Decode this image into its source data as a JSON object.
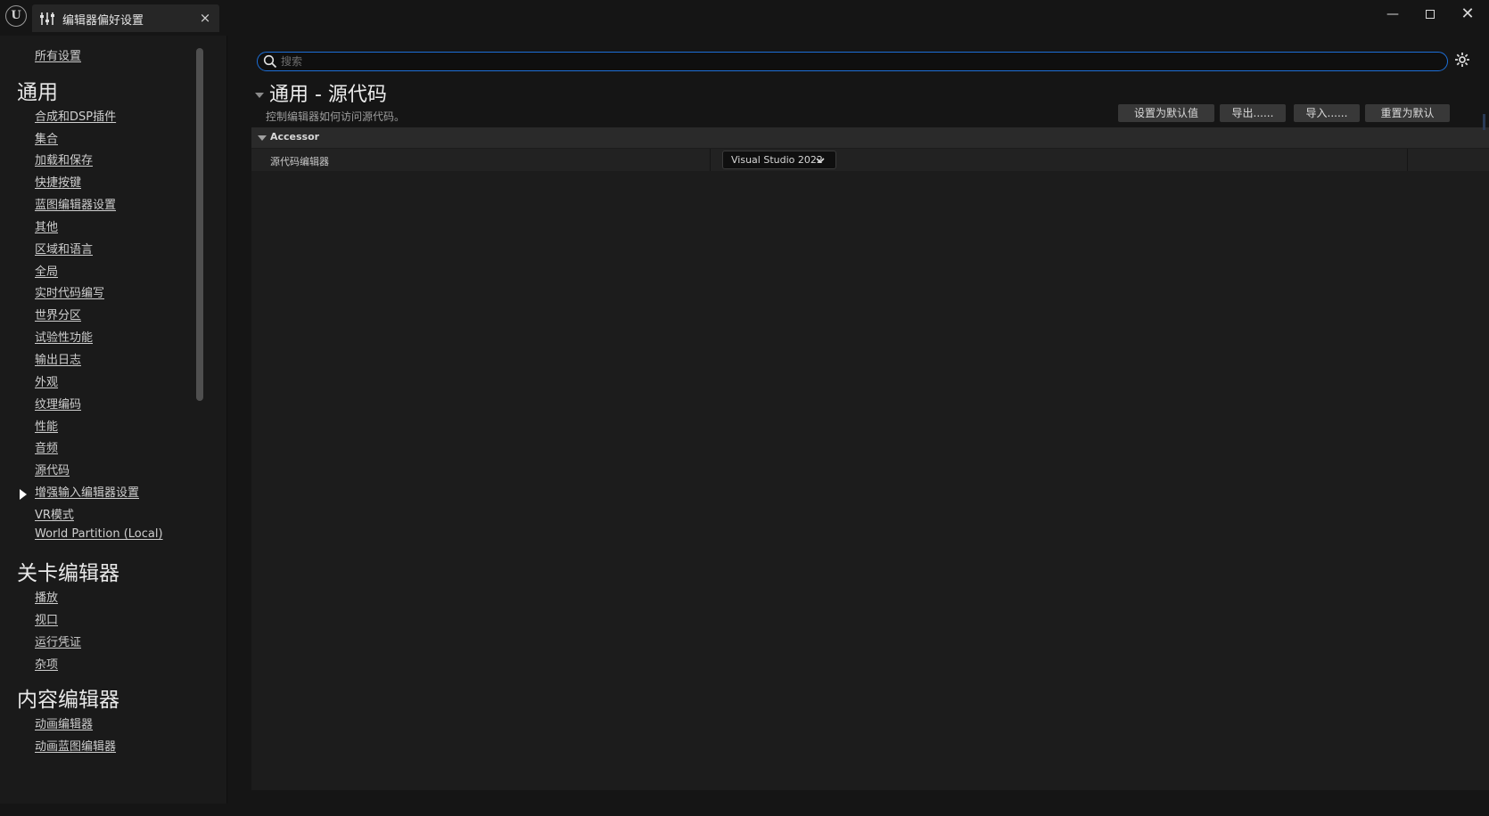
{
  "titlebar": {
    "app_logo": "U",
    "tab_title": "编辑器偏好设置",
    "tab_close": "×",
    "min": "—",
    "close": "✕"
  },
  "sidebar": {
    "all_settings": "所有设置",
    "groups": [
      {
        "title": "通用",
        "items": [
          "合成和DSP插件",
          "集合",
          "加载和保存",
          "快捷按键",
          "蓝图编辑器设置",
          "其他",
          "区域和语言",
          "全局",
          "实时代码编写",
          "世界分区",
          "试验性功能",
          "输出日志",
          "外观",
          "纹理编码",
          "性能",
          "音频",
          "源代码",
          "增强输入编辑器设置",
          "VR模式",
          "World Partition (Local)"
        ]
      },
      {
        "title": "关卡编辑器",
        "items": [
          "播放",
          "视口",
          "运行凭证",
          "杂项"
        ]
      },
      {
        "title": "内容编辑器",
        "items": [
          "动画编辑器",
          "动画蓝图编辑器"
        ]
      }
    ],
    "active_item": "源代码"
  },
  "main": {
    "search": {
      "placeholder": "搜索",
      "value": ""
    },
    "section_title": "通用 - 源代码",
    "section_description": "控制编辑器如何访问源代码。",
    "buttons": {
      "set_default": "设置为默认值",
      "export": "导出......",
      "import": "导入......",
      "reset": "重置为默认"
    },
    "category": {
      "label": "Accessor",
      "properties": [
        {
          "name": "源代码编辑器",
          "value": "Visual Studio 2022"
        }
      ]
    }
  },
  "colors": {
    "background": "#151515",
    "panel": "#1c1c1c",
    "search_border": "#1d6fd8",
    "button": "#383838",
    "text": "#c0c0c0"
  }
}
